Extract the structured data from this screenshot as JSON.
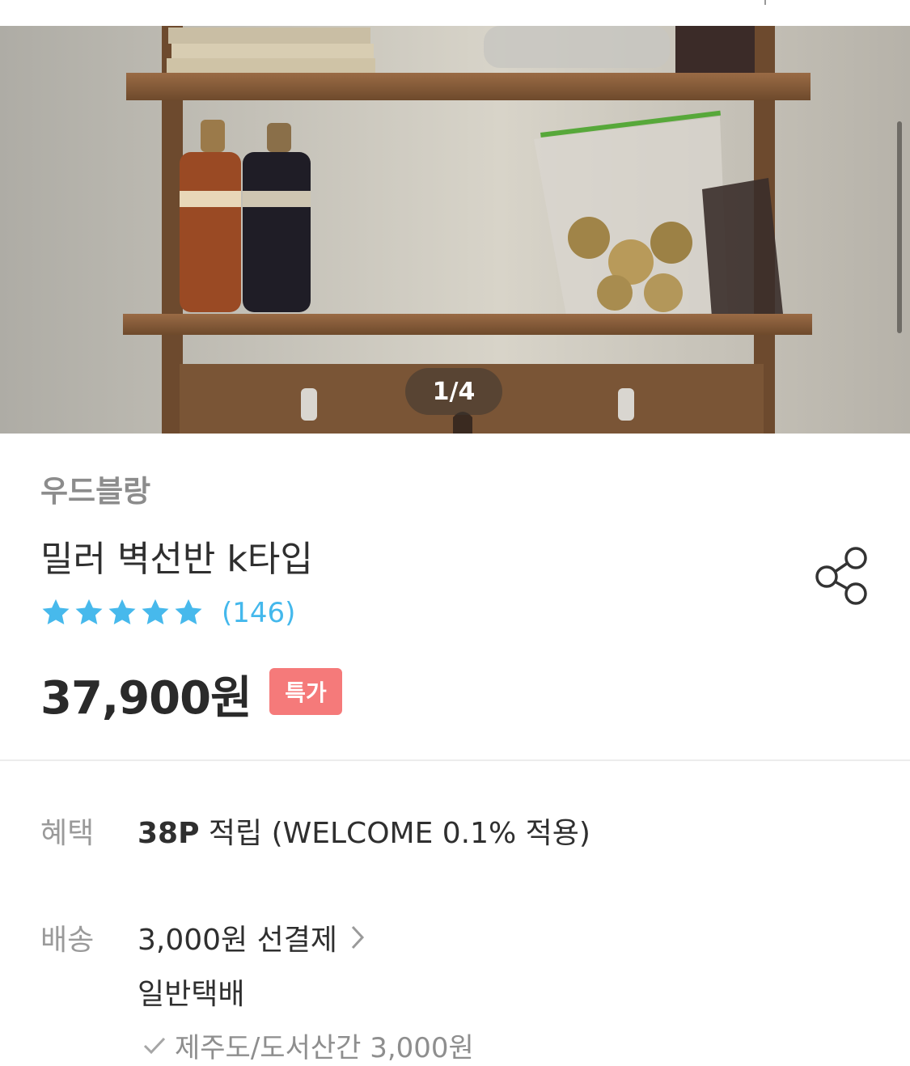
{
  "gallery": {
    "pager_label": "1/4",
    "image_alt": "wooden wall shelf with syrup bottles and dried fruit bags"
  },
  "product": {
    "brand": "우드블랑",
    "title": "밀러 벽선반 k타입",
    "rating": {
      "stars": 5,
      "max": 5,
      "count_label": "(146)"
    },
    "price": "37,900원",
    "badge": "특가"
  },
  "benefit": {
    "label": "혜택",
    "points_bold": "38P",
    "points_rest": " 적립 (WELCOME 0.1% 적용)"
  },
  "delivery": {
    "label": "배송",
    "fee": "3,000원 선결제",
    "method": "일반택배",
    "extra": "제주도/도서산간 3,000원"
  },
  "colors": {
    "star": "#47b9ec",
    "review_count": "#44b8ec",
    "badge_bg": "#f57a7a",
    "label_gray": "#9a9a9a"
  },
  "icons": {
    "share": "share-icon",
    "star": "star-icon",
    "chevron": "chevron-right-icon",
    "check": "check-icon"
  }
}
